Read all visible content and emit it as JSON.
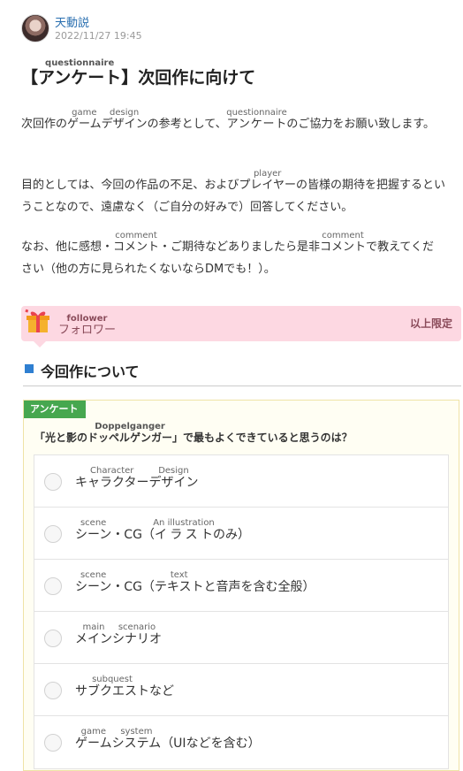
{
  "post": {
    "author": "天動説",
    "date": "2022/11/27 19:45",
    "title": {
      "open": "【",
      "ruby_base": "アンケート",
      "ruby_text": "questionnaire",
      "rest": "】次回作に向けて"
    },
    "para1": {
      "t1": "次回作の",
      "r1_base": "ゲーム",
      "r1_text": "game",
      "r2_base": "デザイン",
      "r2_text": "design",
      "t2": "の参考として、",
      "r3_base": "アンケート",
      "r3_text": "questionnaire",
      "t3": "のご協力をお願い致します。"
    },
    "para2": {
      "t1": "目的としては、今回の作品の不足、および",
      "r1_base": "プレイヤー",
      "r1_text": "player",
      "t2": "の皆様の期待を把握するということなので、遠慮なく（ご自分の好みで）回答してください。"
    },
    "para3": {
      "t1": "なお、他に感想・",
      "r1_base": "コメント",
      "r1_text": "comment",
      "t2": "・ご期待などありましたら是非",
      "r2_base": "コメント",
      "r2_text": "comment",
      "t3": "で教えてください（他の方に見られたくないならDMでも！）。"
    }
  },
  "limit": {
    "ruby_base": "フォロワー",
    "ruby_text": "follower",
    "right": "以上限定",
    "icon": "gift-icon"
  },
  "section": {
    "title": "今回作について"
  },
  "survey": {
    "tag": "アンケート",
    "question": {
      "t1": "「光と影の",
      "r1_base": "ドッペルゲンガー",
      "r1_text": "Doppelganger",
      "t2": "」で最もよくできていると思うのは？"
    },
    "options": [
      {
        "r1_base": "キャラクター",
        "r1_text": "Character",
        "r2_base": "デザイン",
        "r2_text": "Design",
        "tail": ""
      },
      {
        "pre": "",
        "r1_base": "シーン",
        "r1_text": "scene",
        "mid": "・CG（",
        "r2_base": "イラスト",
        "r2_text": "An illustration",
        "tail": "のみ）"
      },
      {
        "pre": "",
        "r1_base": "シーン",
        "r1_text": "scene",
        "mid": "・CG（",
        "r2_base": "テキスト",
        "r2_text": "text",
        "tail": "と音声を含む全般）"
      },
      {
        "r1_base": "メイン",
        "r1_text": "main",
        "r2_base": "シナリオ",
        "r2_text": "scenario",
        "tail": ""
      },
      {
        "r1_base": "サブクエスト",
        "r1_text": "subquest",
        "tail": "など"
      },
      {
        "r1_base": "ゲーム",
        "r1_text": "game",
        "r2_base": "システム",
        "r2_text": "system",
        "tail": "（UIなどを含む）"
      }
    ]
  }
}
